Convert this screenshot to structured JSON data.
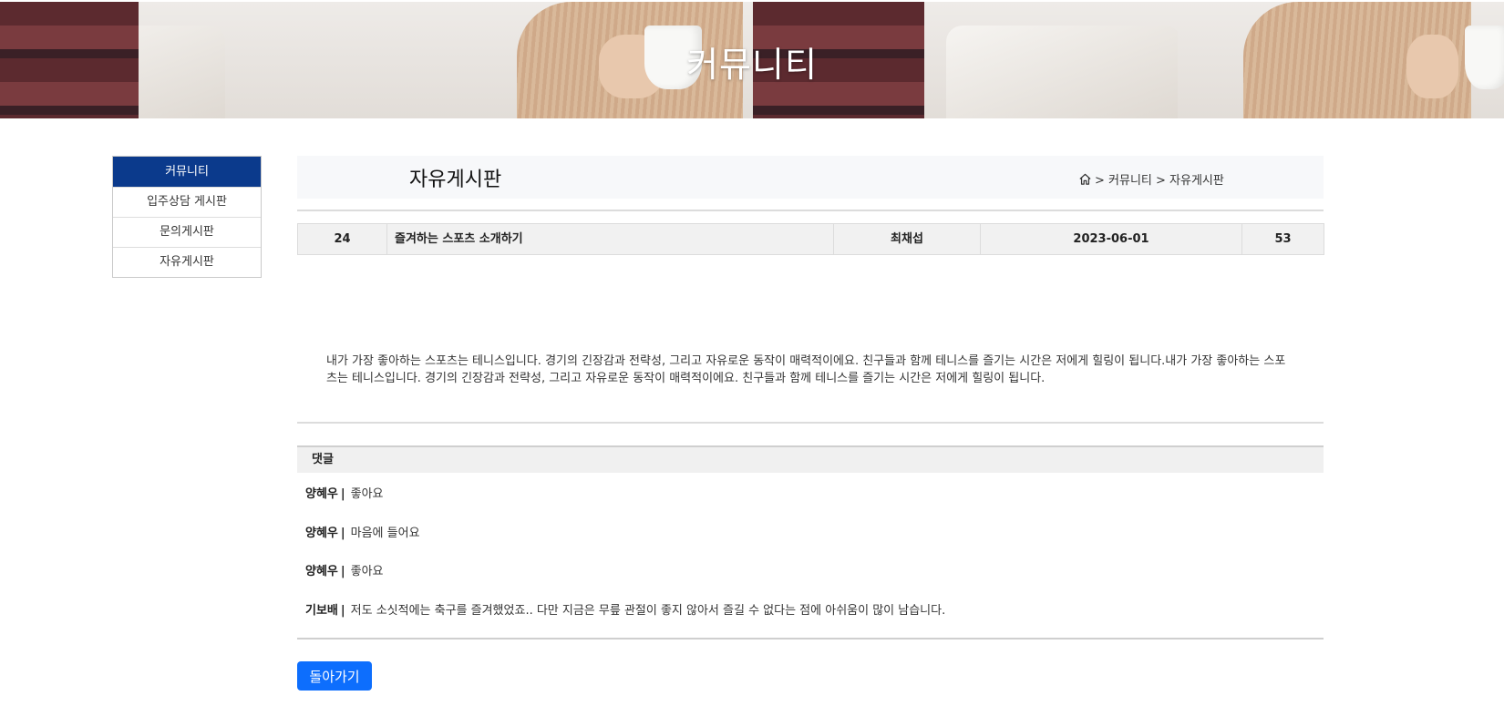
{
  "banner": {
    "title": "커뮤니티"
  },
  "sidebar": {
    "heading": "커뮤니티",
    "items": [
      {
        "label": "입주상담 게시판"
      },
      {
        "label": "문의게시판"
      },
      {
        "label": "자유게시판"
      }
    ]
  },
  "header": {
    "title": "자유게시판",
    "breadcrumb": "> 커뮤니티 > 자유게시판",
    "home_icon": "home-icon"
  },
  "post": {
    "number": "24",
    "title": "즐겨하는 스포츠 소개하기",
    "author": "최채섭",
    "date": "2023-06-01",
    "views": "53",
    "body": "내가 가장 좋아하는 스포츠는 테니스입니다. 경기의 긴장감과 전략성, 그리고 자유로운 동작이 매력적이에요. 친구들과 함께 테니스를 즐기는 시간은 저에게 힐링이 됩니다.내가 가장 좋아하는 스포츠는 테니스입니다. 경기의 긴장감과 전략성, 그리고 자유로운 동작이 매력적이에요. 친구들과 함께 테니스를 즐기는 시간은 저에게 힐링이 됩니다."
  },
  "comments": {
    "heading": "댓글",
    "separator": "|",
    "items": [
      {
        "author": "양혜우",
        "text": "좋아요"
      },
      {
        "author": "양혜우",
        "text": "마음에 들어요"
      },
      {
        "author": "양혜우",
        "text": "좋아요"
      },
      {
        "author": "기보배",
        "text": "저도 소싯적에는 축구를 즐겨했었죠.. 다만 지금은 무릎 관절이 좋지 않아서 즐길 수 없다는 점에 아쉬움이 많이 남습니다."
      }
    ]
  },
  "actions": {
    "back_label": "돌아가기"
  },
  "colors": {
    "sidebar_active": "#0b3a8c",
    "button": "#0d6efd"
  }
}
